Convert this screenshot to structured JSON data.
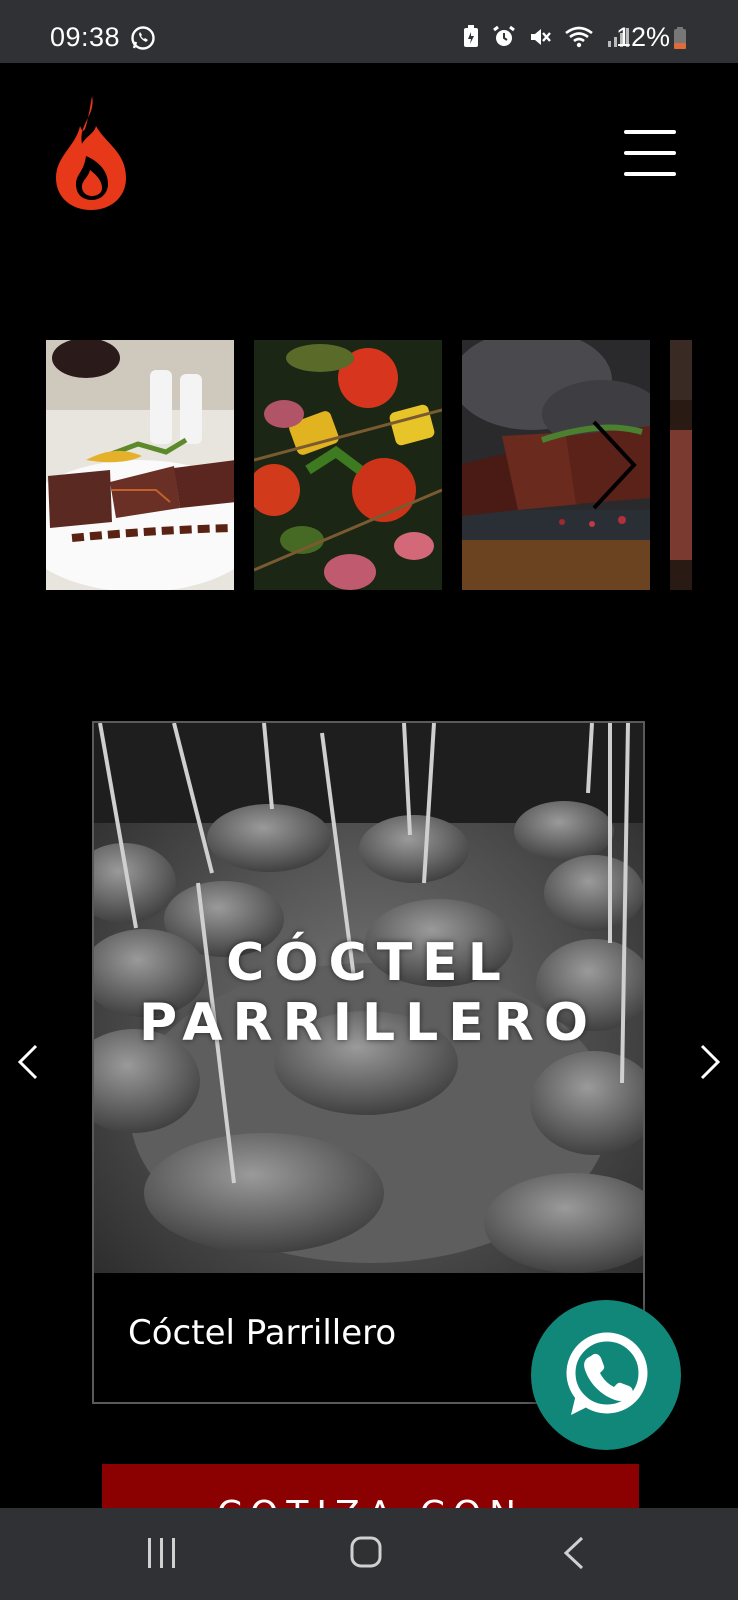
{
  "status_bar": {
    "time": "09:38",
    "battery": "12%",
    "icons": [
      "whatsapp-icon",
      "battery-saver-icon",
      "alarm-icon",
      "mute-icon",
      "wifi-icon",
      "signal-icon",
      "battery-icon"
    ]
  },
  "header": {
    "logo": "flame-logo",
    "menu_icon": "hamburger-menu-icon"
  },
  "gallery": {
    "thumbnails": [
      "grilled-steak-plate",
      "grilled-vegetables",
      "steak-on-board",
      "steak-partial"
    ],
    "next_icon": "chevron-right-icon"
  },
  "slider": {
    "overlay_title_line1": "CÓCTEL",
    "overlay_title_line2": "PARRILLERO",
    "caption": "Cóctel Parrillero",
    "prev_icon": "chevron-left-icon",
    "next_icon": "chevron-right-icon"
  },
  "fab": {
    "icon": "whatsapp-icon"
  },
  "cta": {
    "label": "COTIZA CON NOSOTROS"
  },
  "nav_bar": {
    "icons": [
      "recents-icon",
      "home-icon",
      "back-icon"
    ]
  },
  "colors": {
    "accent_red": "#8b0000",
    "logo_red": "#e8381a",
    "whatsapp_green": "#11877a",
    "bars": "#2f3134"
  }
}
